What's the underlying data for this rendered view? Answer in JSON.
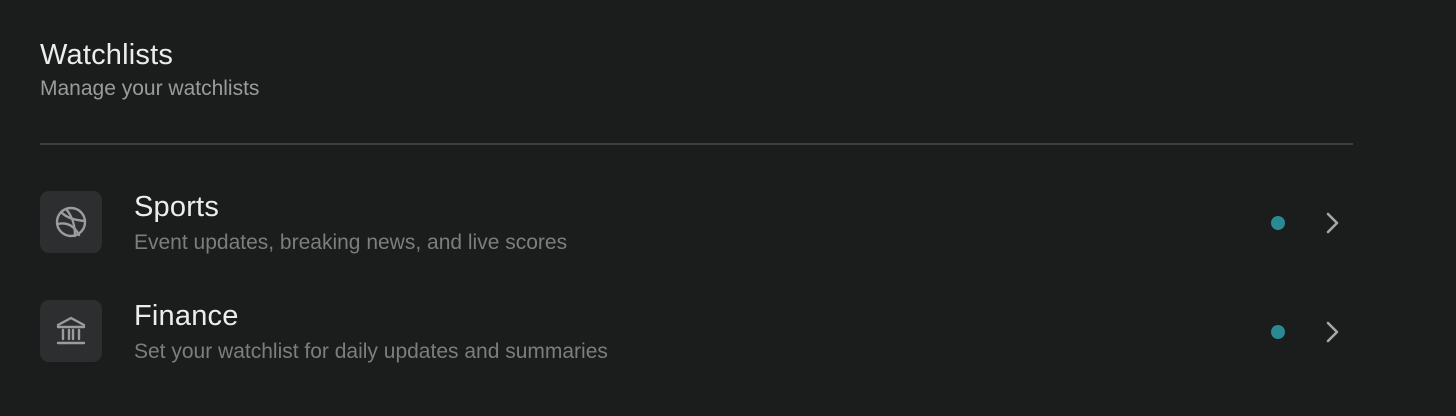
{
  "header": {
    "title": "Watchlists",
    "subtitle": "Manage your watchlists"
  },
  "watchlists": [
    {
      "title": "Sports",
      "description": "Event updates, breaking news, and live scores",
      "icon": "basketball-icon",
      "status_color": "#2a8a93"
    },
    {
      "title": "Finance",
      "description": "Set your watchlist for daily updates and summaries",
      "icon": "bank-icon",
      "status_color": "#2a8a93"
    }
  ],
  "colors": {
    "background": "#1b1c1c",
    "tile": "#2c2e2f",
    "accent_dot": "#2a8a93"
  }
}
